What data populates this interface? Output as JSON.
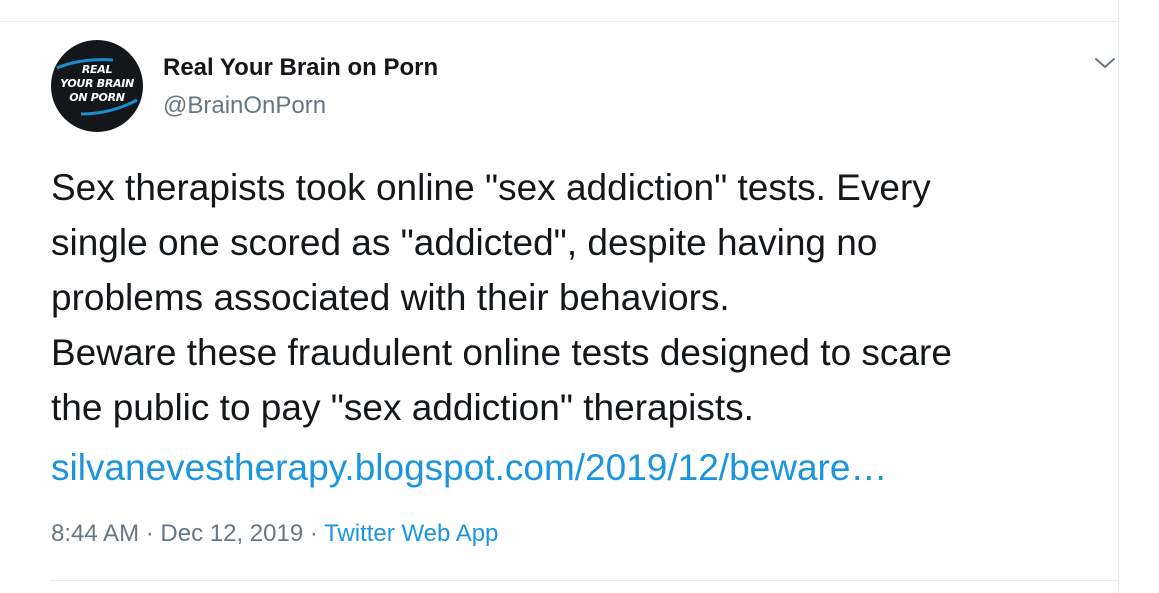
{
  "author": {
    "name": "Real Your Brain on Porn",
    "handle": "@BrainOnPorn",
    "avatar_text": [
      "REAL",
      "YOUR BRAIN",
      "ON PORN"
    ]
  },
  "tweet": {
    "text_lines": [
      "Sex therapists took online \"sex addiction\" tests. Every",
      "single one scored as \"addicted\", despite having no",
      "problems associated with their behaviors.",
      "Beware these fraudulent online tests designed to scare",
      "the public to pay \"sex addiction\" therapists."
    ],
    "link_text": "silvanevestherapy.blogspot.com/2019/12/beware…"
  },
  "meta": {
    "time": "8:44 AM",
    "separator": "·",
    "date": "Dec 12, 2019",
    "source": "Twitter Web App"
  },
  "icons": {
    "caret": "chevron-down-icon"
  },
  "colors": {
    "text": "#14171a",
    "secondary": "#657786",
    "link": "#1b95e0",
    "divider": "#e6ecf0"
  }
}
